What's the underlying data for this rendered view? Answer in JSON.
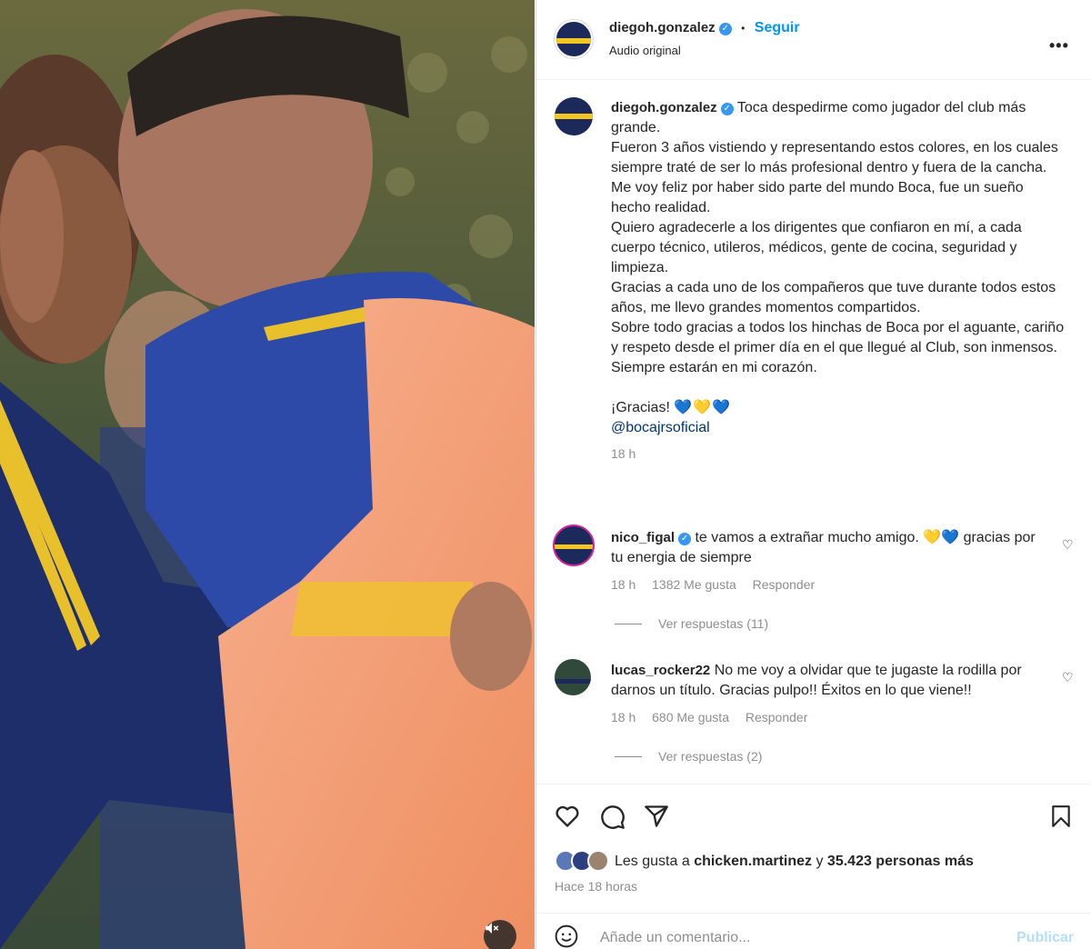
{
  "header": {
    "username": "diegoh.gonzalez",
    "separator": "•",
    "follow_label": "Seguir",
    "audio_label": "Audio original",
    "more_label": "•••"
  },
  "caption": {
    "username": "diegoh.gonzalez",
    "lines": [
      "Toca despedirme como jugador del club más grande.",
      "Fueron 3 años vistiendo y representando estos colores, en los cuales siempre traté de ser lo más profesional dentro y fuera de la cancha.",
      "Me voy feliz por haber sido parte del mundo Boca, fue un sueño hecho realidad.",
      "Quiero agradecerle a los dirigentes que confiaron en mí, a cada cuerpo técnico, utileros, médicos, gente de cocina, seguridad y limpieza.",
      "Gracias a cada uno de los compañeros que tuve durante todos estos años, me llevo grandes momentos compartidos.",
      "Sobre todo gracias a todos los hinchas de Boca por el aguante, cariño y respeto desde el primer día en el que llegué al Club, son inmensos.",
      "Siempre estarán en mi corazón."
    ],
    "thanks": "¡Gracias!",
    "thanks_hearts": "💙💛💙",
    "mention": "@bocajrsoficial",
    "time": "18 h"
  },
  "comments": [
    {
      "username": "nico_figal",
      "verified": true,
      "text_before": "te vamos a extrañar mucho amigo.",
      "hearts": "💛💙",
      "text_after": "gracias por tu energia de siempre",
      "time": "18 h",
      "likes": "1382 Me gusta",
      "reply": "Responder",
      "view_replies": "Ver respuestas (11)"
    },
    {
      "username": "lucas_rocker22",
      "verified": false,
      "text": "No me voy a olvidar que te jugaste la rodilla por darnos un título. Gracias pulpo!! Éxitos en lo que viene!!",
      "time": "18 h",
      "likes": "680 Me gusta",
      "reply": "Responder",
      "view_replies": "Ver respuestas (2)"
    }
  ],
  "likes": {
    "prefix": "Les gusta a",
    "user": "chicken.martinez",
    "middle": "y",
    "count": "35.423 personas más"
  },
  "posted_ago": "Hace 18 horas",
  "add_comment": {
    "placeholder": "Añade un comentario...",
    "post_label": "Publicar"
  },
  "colors": {
    "accent": "#0095f6",
    "verified": "#3897f0",
    "boca_blue": "#1b2a5a",
    "boca_yellow": "#f3c623",
    "bib_orange": "#f5a27a"
  },
  "icons": [
    "volume-off-icon",
    "heart-icon",
    "comment-icon",
    "share-icon",
    "bookmark-icon",
    "emoji-icon",
    "more-icon",
    "verified-icon"
  ]
}
